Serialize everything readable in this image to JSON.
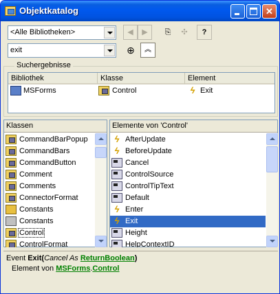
{
  "window": {
    "title": "Objektkatalog"
  },
  "toolbar": {
    "library_combo_value": "<Alle Bibliotheken>",
    "search_combo_value": "exit"
  },
  "search_results": {
    "group_label": "Suchergebnisse",
    "columns": [
      "Bibliothek",
      "Klasse",
      "Element"
    ],
    "rows": [
      {
        "library": "MSForms",
        "class": "Control",
        "element": "Exit"
      }
    ]
  },
  "classes_panel": {
    "header": "Klassen",
    "items": [
      {
        "label": "CommandBarPopup",
        "icon": "class-icon"
      },
      {
        "label": "CommandBars",
        "icon": "class-icon"
      },
      {
        "label": "CommandButton",
        "icon": "class-icon"
      },
      {
        "label": "Comment",
        "icon": "class-icon"
      },
      {
        "label": "Comments",
        "icon": "class-icon"
      },
      {
        "label": "ConnectorFormat",
        "icon": "class-icon"
      },
      {
        "label": "Constants",
        "icon": "enum-icon"
      },
      {
        "label": "Constants",
        "icon": "module-icon"
      },
      {
        "label": "Control",
        "icon": "class-icon",
        "focused": true
      },
      {
        "label": "ControlFormat",
        "icon": "class-icon"
      }
    ]
  },
  "members_panel": {
    "header": "Elemente von 'Control'",
    "items": [
      {
        "label": "AfterUpdate",
        "icon": "event-icon"
      },
      {
        "label": "BeforeUpdate",
        "icon": "event-icon"
      },
      {
        "label": "Cancel",
        "icon": "property-icon"
      },
      {
        "label": "ControlSource",
        "icon": "property-icon"
      },
      {
        "label": "ControlTipText",
        "icon": "property-icon"
      },
      {
        "label": "Default",
        "icon": "property-icon"
      },
      {
        "label": "Enter",
        "icon": "event-icon"
      },
      {
        "label": "Exit",
        "icon": "event-icon",
        "selected": true
      },
      {
        "label": "Height",
        "icon": "property-icon"
      },
      {
        "label": "HelpContextID",
        "icon": "property-icon"
      }
    ]
  },
  "details": {
    "kind": "Event",
    "name": "Exit",
    "open_paren": "(",
    "param_text": "Cancel As ",
    "param_type": "ReturnBoolean",
    "close_paren": ")",
    "member_of_label": "Element von ",
    "library_link": "MSForms",
    "dot": ".",
    "class_link": "Control"
  },
  "colors": {
    "title_bar": "#0058ee",
    "selection": "#316ac5",
    "link": "#008000",
    "window_bg": "#ece9d8"
  }
}
